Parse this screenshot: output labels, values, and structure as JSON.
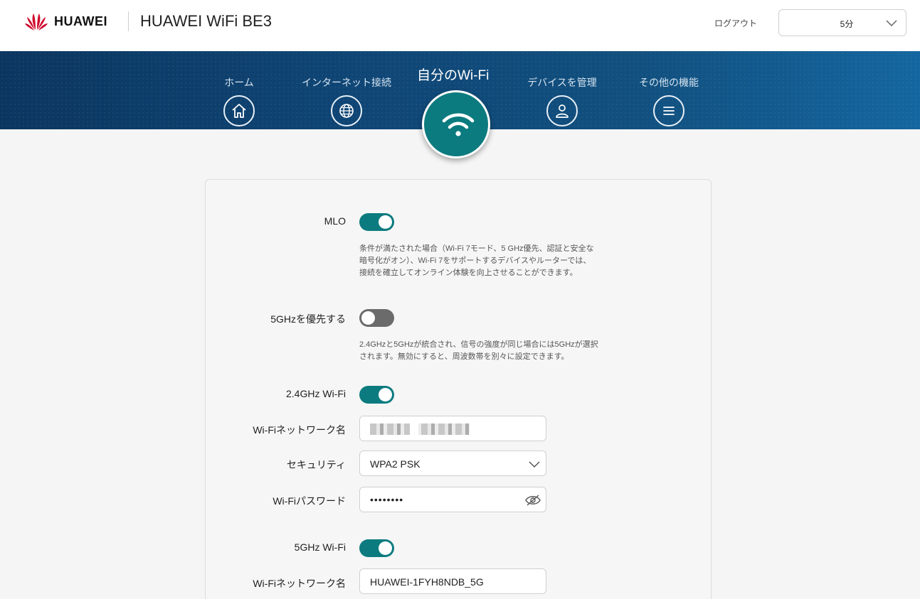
{
  "header": {
    "brand": "HUAWEI",
    "product": "HUAWEI WiFi BE3",
    "logout_label": "ログアウト",
    "timeout_value": "5分"
  },
  "nav": {
    "items": [
      {
        "label": "ホーム",
        "icon": "home-icon"
      },
      {
        "label": "インターネット接続",
        "icon": "globe-icon"
      },
      {
        "label": "自分のWi-Fi",
        "icon": "wifi-icon",
        "active": true
      },
      {
        "label": "デバイスを管理",
        "icon": "user-icon"
      },
      {
        "label": "その他の機能",
        "icon": "menu-icon"
      }
    ]
  },
  "settings": {
    "mlo": {
      "label": "MLO",
      "enabled": true,
      "description_lines": [
        "条件が満たされた場合（Wi-Fi 7モード、5 GHz優先、認証と安全な",
        "暗号化がオン）、Wi-Fi 7をサポートするデバイスやルーターでは、",
        "接続を確立してオンライン体験を向上させることができます。"
      ]
    },
    "prefer_5g": {
      "label": "5GHzを優先する",
      "enabled": false,
      "description_lines": [
        "2.4GHzと5GHzが統合され、信号の強度が同じ場合には5GHzが選択",
        "されます。無効にすると、周波数帯を別々に設定できます。"
      ]
    },
    "wifi_24": {
      "label": "2.4GHz Wi-Fi",
      "enabled": true,
      "ssid_label": "Wi-Fiネットワーク名",
      "security_label": "セキュリティ",
      "security_value": "WPA2 PSK",
      "password_label": "Wi-Fiパスワード",
      "password_value": "••••••••"
    },
    "wifi_5": {
      "label": "5GHz Wi-Fi",
      "enabled": true,
      "ssid_label": "Wi-Fiネットワーク名",
      "ssid_value": "HUAWEI-1FYH8NDB_5G"
    }
  },
  "colors": {
    "accent": "#0c7b7f",
    "nav_dark": "#0b3660",
    "nav_light": "#1466a0",
    "brand_red": "#cf0a2c"
  }
}
